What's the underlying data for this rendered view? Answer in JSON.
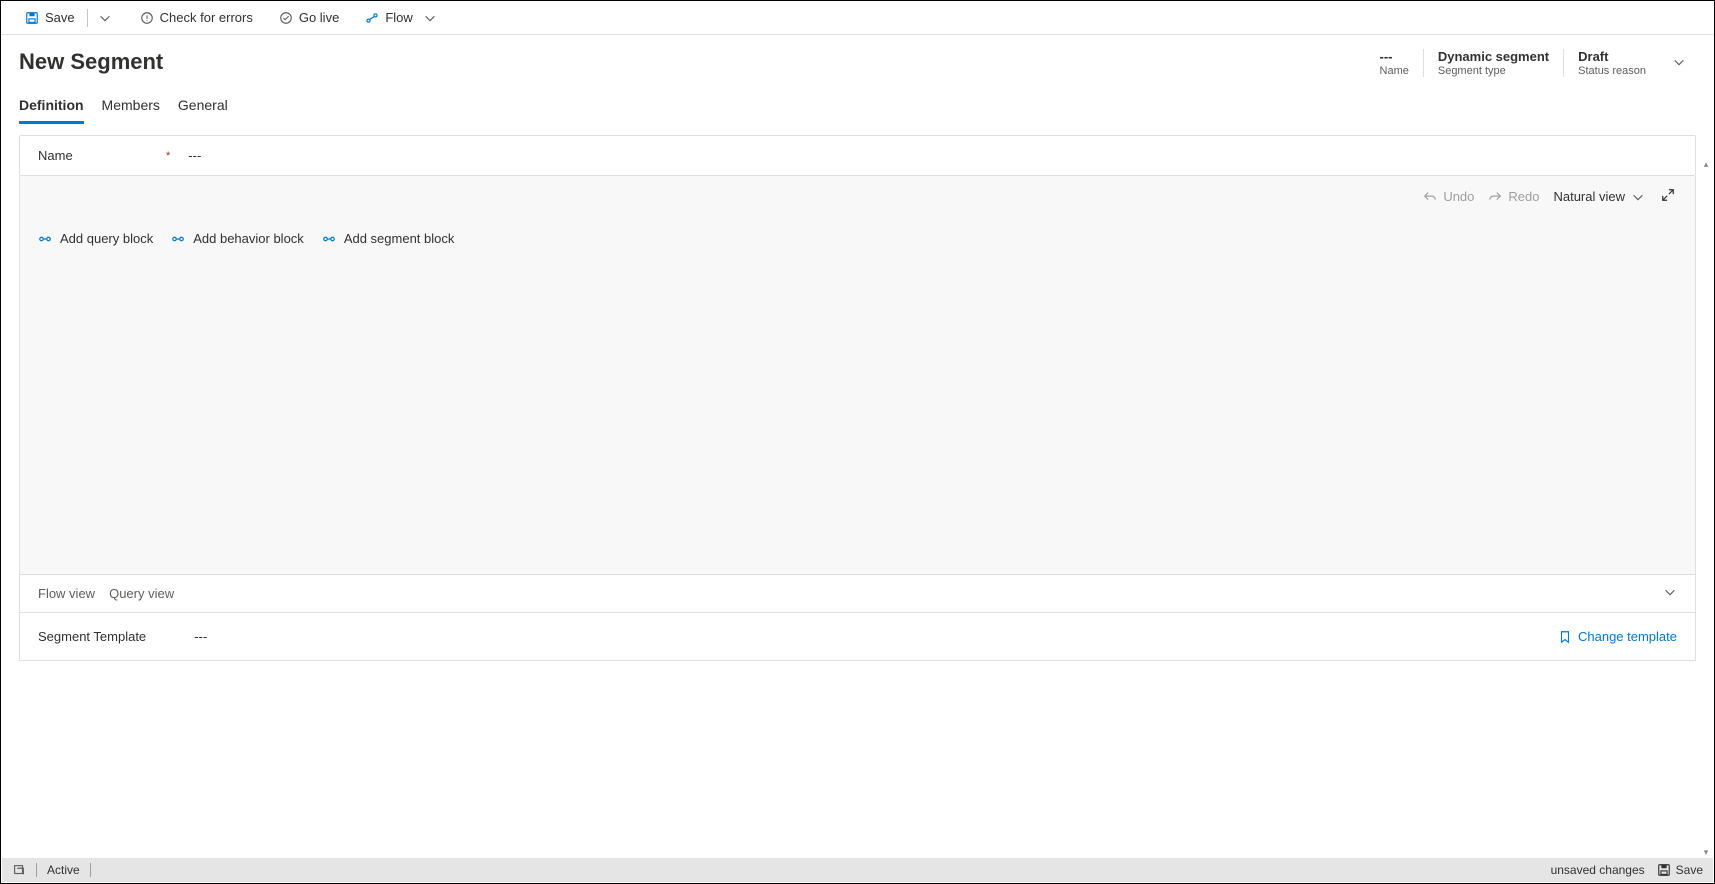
{
  "toolbar": {
    "save": "Save",
    "check_errors": "Check for errors",
    "go_live": "Go live",
    "flow": "Flow"
  },
  "header": {
    "title": "New Segment",
    "fields": [
      {
        "value": "---",
        "label": "Name"
      },
      {
        "value": "Dynamic segment",
        "label": "Segment type"
      },
      {
        "value": "Draft",
        "label": "Status reason"
      }
    ]
  },
  "tabs": [
    {
      "label": "Definition",
      "active": true
    },
    {
      "label": "Members",
      "active": false
    },
    {
      "label": "General",
      "active": false
    }
  ],
  "name_field": {
    "label": "Name",
    "required_mark": "*",
    "value": "---"
  },
  "designer": {
    "undo": "Undo",
    "redo": "Redo",
    "view_mode": "Natural view",
    "blocks": [
      "Add query block",
      "Add behavior block",
      "Add segment block"
    ]
  },
  "views": {
    "flow": "Flow view",
    "query": "Query view"
  },
  "template": {
    "label": "Segment Template",
    "value": "---",
    "change": "Change template"
  },
  "statusbar": {
    "status": "Active",
    "unsaved": "unsaved changes",
    "save": "Save"
  }
}
